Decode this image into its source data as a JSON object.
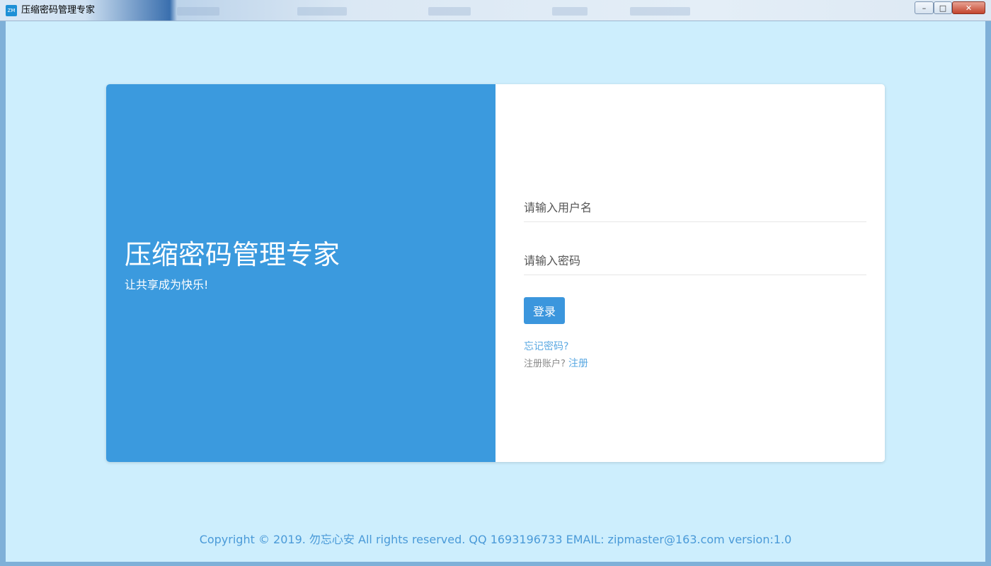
{
  "window": {
    "icon_text": "ZM",
    "title": "压缩密码管理专家",
    "controls": {
      "minimize": "–",
      "maximize": "□",
      "close": "✕"
    }
  },
  "login": {
    "app_title": "压缩密码管理专家",
    "slogan": "让共享成为快乐!",
    "username_placeholder": "请输入用户名",
    "username_value": "",
    "password_placeholder": "请输入密码",
    "password_value": "",
    "login_button": "登录",
    "forgot_password": "忘记密码?",
    "register_prompt": "注册账户?",
    "register_link": "注册"
  },
  "footer": {
    "text": "Copyright © 2019. 勿忘心安 All rights reserved. QQ 1693196733 EMAIL: zipmaster@163.com  version:1.0"
  },
  "colors": {
    "left_panel": "#3b9ade",
    "background": "#cdeefd",
    "accent": "#3b96dd",
    "link": "#5aa8e2"
  }
}
